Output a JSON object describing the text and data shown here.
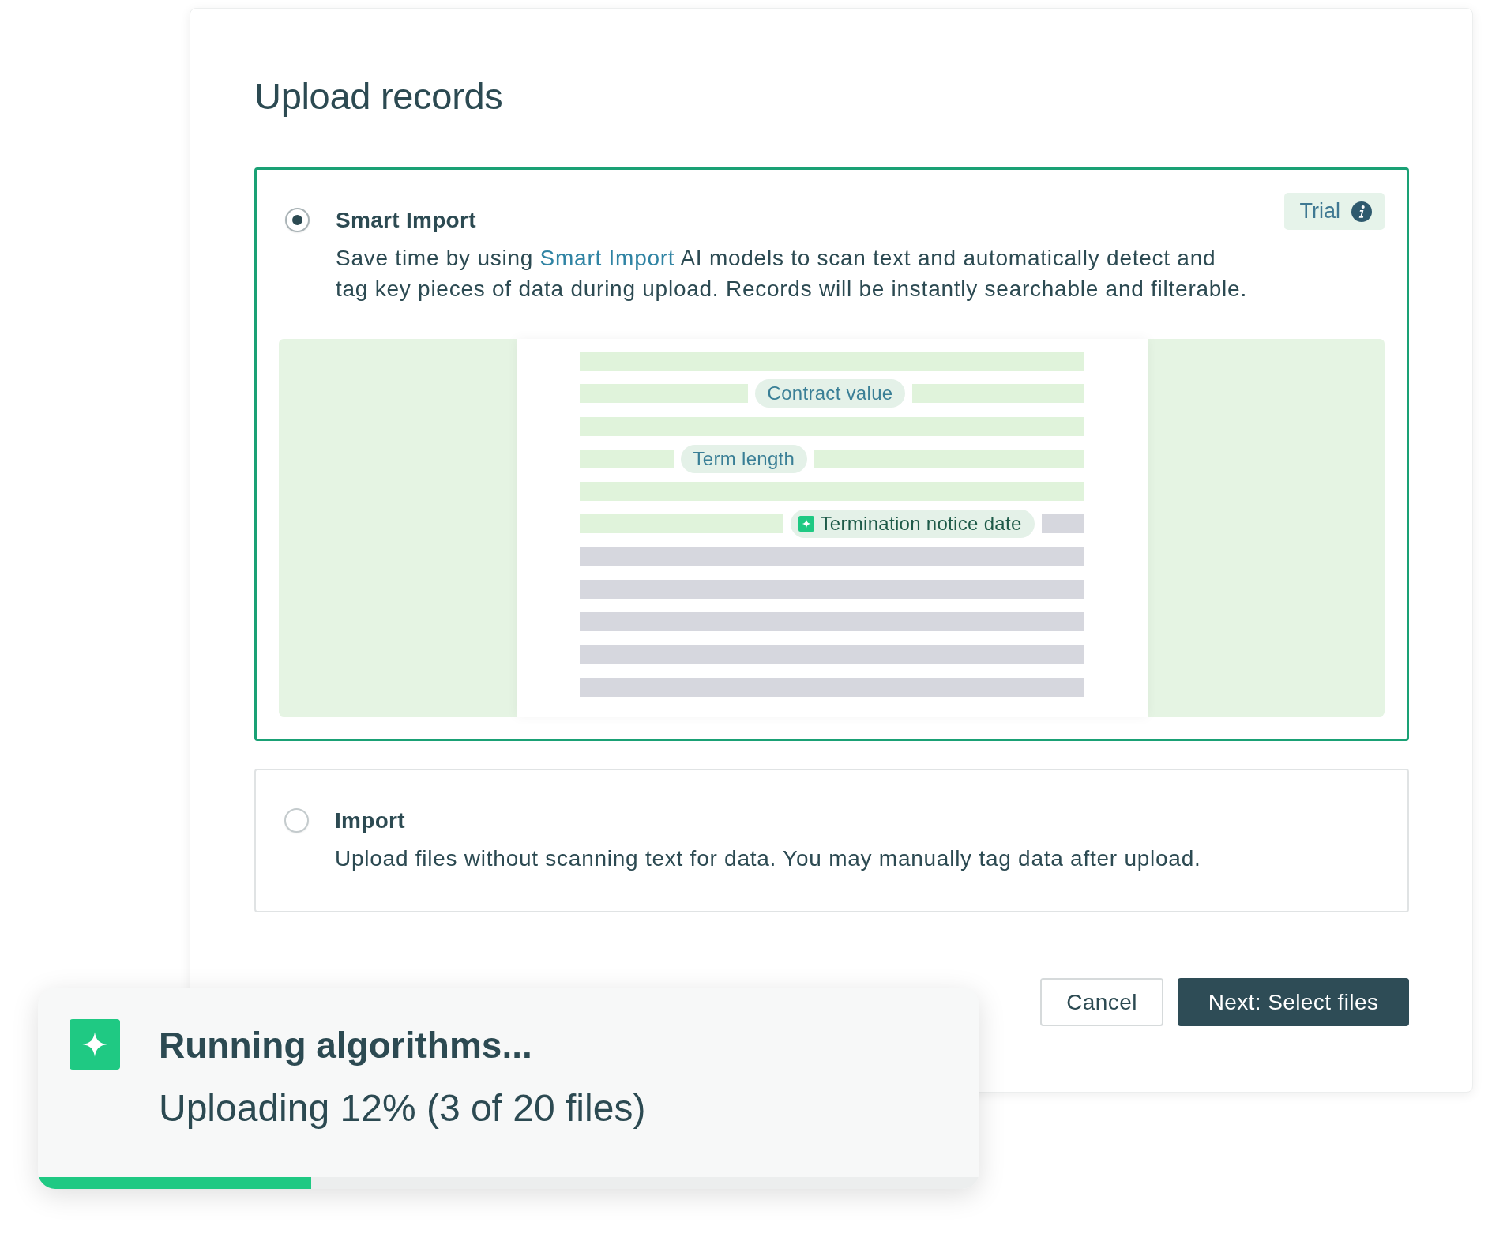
{
  "dialog": {
    "title": "Upload records"
  },
  "options": [
    {
      "label": "Smart Import",
      "selected": true,
      "badge": {
        "label": "Trial"
      },
      "description": [
        {
          "text": "Save time by using ",
          "kind": "text"
        },
        {
          "text": "Smart Import",
          "kind": "link"
        },
        {
          "text": " AI models to scan text and automatically detect and tag key pieces of data during upload. Records will be instantly searchable and filterable.",
          "kind": "text"
        }
      ],
      "preview": {
        "lines": [
          {
            "scanned": true
          },
          {
            "scanned": true,
            "tag": {
              "label": "Contract value",
              "kind": "detected"
            },
            "scanned_after_tag": true
          },
          {
            "scanned": true
          },
          {
            "scanned": true,
            "tag": {
              "label": "Term length",
              "kind": "detected"
            },
            "scanned_after_tag": true
          },
          {
            "scanned": true
          },
          {
            "scanned": true,
            "tag": {
              "label": "Termination notice date",
              "kind": "ai"
            },
            "scanned_after_tag": false
          },
          {
            "scanned": false
          },
          {
            "scanned": false
          },
          {
            "scanned": false
          },
          {
            "scanned": false
          },
          {
            "scanned": false
          }
        ]
      }
    },
    {
      "label": "Import",
      "selected": false,
      "description": [
        {
          "text": "Upload files without scanning text for data. You may manually tag data after upload.",
          "kind": "text"
        }
      ]
    }
  ],
  "buttons": [
    {
      "label": "Cancel",
      "kind": "secondary"
    },
    {
      "label": "Next: Select files",
      "kind": "primary"
    }
  ],
  "toast": {
    "title": "Running algorithms...",
    "message": "Uploading 12% (3 of 20 files)",
    "level": 0.29
  }
}
